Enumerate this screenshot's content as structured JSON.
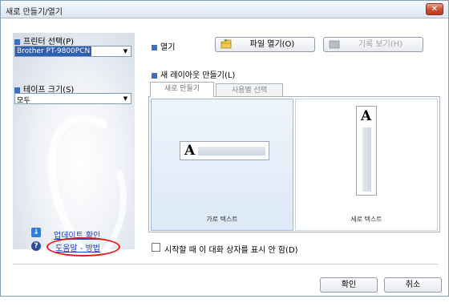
{
  "window": {
    "title": "새로 만들기/열기",
    "close_glyph": "✕"
  },
  "left": {
    "printer_label": "프린터 선택(P)",
    "printer_value": "Brother PT-9800PCN",
    "tape_label": "테이프 크기(S)",
    "tape_value": "모두",
    "update_link": "업데이트 확인",
    "help_link": "도움말 - 방법"
  },
  "open_section": {
    "label": "열기",
    "open_file_button": "파일 열기(O)",
    "history_button": "기록 보기(H)"
  },
  "new_layout": {
    "label": "새 레이아웃 만들기(L)",
    "tabs": [
      {
        "label": "새로 만들기",
        "active": true
      },
      {
        "label": "사용별 선택",
        "active": false
      }
    ],
    "options": [
      {
        "label": "가로 텍스트",
        "selected": true
      },
      {
        "label": "세로 텍스트",
        "selected": false
      }
    ],
    "sample_glyph": "A"
  },
  "startup_checkbox": {
    "label": "시작할 때 이 대화 상자를 표시 안 함(D)",
    "checked": false
  },
  "footer": {
    "ok_button": "확인",
    "cancel_button": "취소"
  },
  "icons": {
    "combo_arrow": "▼",
    "help_icon": "?",
    "update_icon": "↓"
  },
  "colors": {
    "accent_square": "#3c6fc4",
    "highlight_oval": "#e0191e",
    "link": "#1a3dbf"
  }
}
